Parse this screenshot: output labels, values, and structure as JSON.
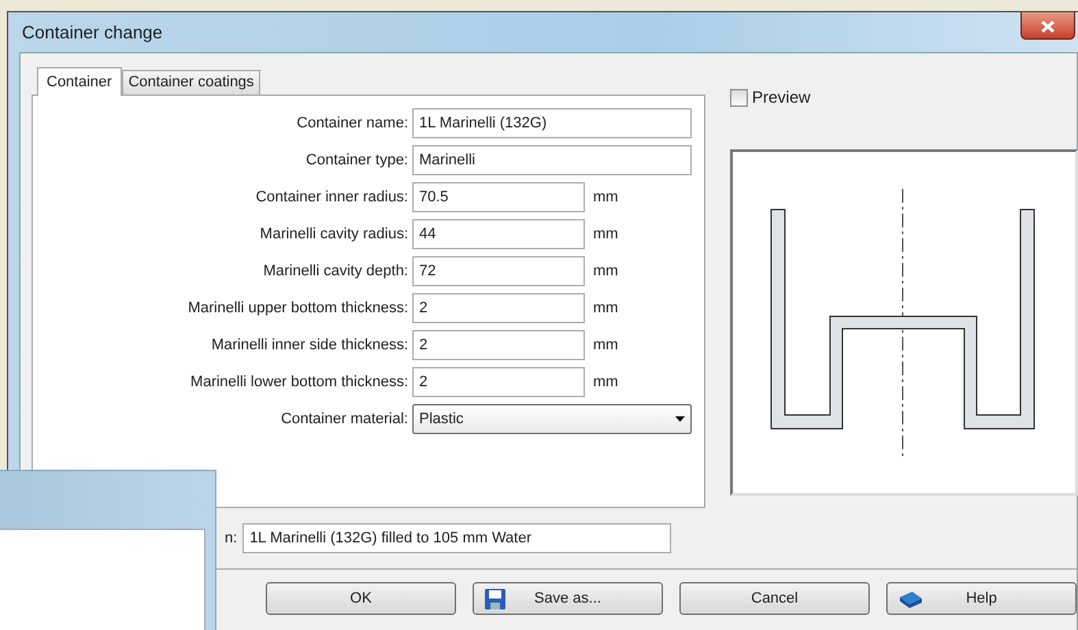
{
  "window": {
    "title": "Container change"
  },
  "tabs": [
    {
      "label": "Container",
      "selected": true
    },
    {
      "label": "Container coatings",
      "selected": false
    }
  ],
  "fields": [
    {
      "kind": "text",
      "label": "Container name:",
      "value": "1L Marinelli (132G)"
    },
    {
      "kind": "text",
      "label": "Container type:",
      "value": "Marinelli"
    },
    {
      "kind": "measure",
      "label": "Container inner radius:",
      "value": "70.5",
      "unit": "mm"
    },
    {
      "kind": "measure",
      "label": "Marinelli cavity radius:",
      "value": "44",
      "unit": "mm"
    },
    {
      "kind": "measure",
      "label": "Marinelli cavity depth:",
      "value": "72",
      "unit": "mm"
    },
    {
      "kind": "measure",
      "label": "Marinelli upper bottom thickness:",
      "value": "2",
      "unit": "mm"
    },
    {
      "kind": "measure",
      "label": "Marinelli inner side thickness:",
      "value": "2",
      "unit": "mm"
    },
    {
      "kind": "measure",
      "label": "Marinelli lower bottom thickness:",
      "value": "2",
      "unit": "mm"
    },
    {
      "kind": "select",
      "label": "Container material:",
      "value": "Plastic"
    }
  ],
  "preview": {
    "label": "Preview",
    "checked": false
  },
  "description": {
    "label": "n:",
    "value": "1L Marinelli (132G) filled to 105 mm Water"
  },
  "buttons": [
    {
      "label": "OK",
      "kind": "plain"
    },
    {
      "label": "Save as...",
      "kind": "save"
    },
    {
      "label": "Cancel",
      "kind": "plain"
    },
    {
      "label": "Help",
      "kind": "help"
    }
  ]
}
